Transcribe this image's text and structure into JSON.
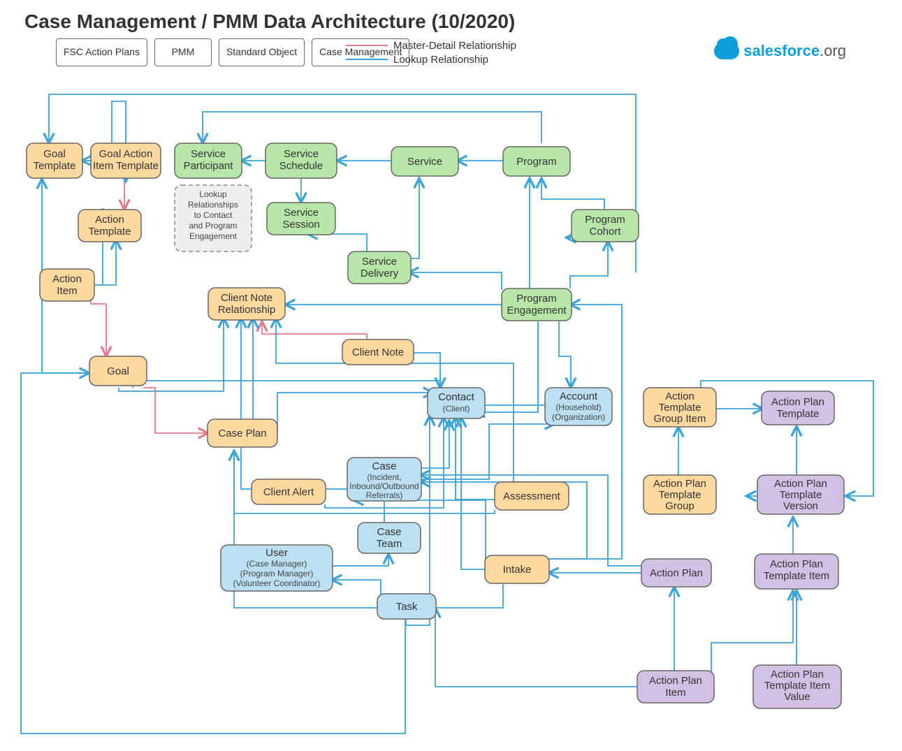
{
  "title": "Case Management / PMM Data Architecture  (10/2020)",
  "logo": {
    "brand": "salesforce",
    "suffix": ".org"
  },
  "colors": {
    "pmm": "#b7e6a8",
    "cm": "#fdd9a0",
    "fsc": "#d3c1e5",
    "std": "#bcdff1",
    "note": "#eeeeee",
    "lookup": "#3ba4d9",
    "master": "#e77a88"
  },
  "legend": {
    "fsc": "FSC Action Plans",
    "pmm": "PMM",
    "std": "Standard Object",
    "cm": "Case Management",
    "master": "Master-Detail Relationship",
    "lookup": "Lookup Relationship"
  },
  "nodes": {
    "goal_template": {
      "label": "Goal Template",
      "cat": "cm"
    },
    "goal_action_item_tmpl": {
      "label": "Goal Action Item Template",
      "cat": "cm"
    },
    "service_participant": {
      "label": "Service Participant",
      "cat": "pmm"
    },
    "service_schedule": {
      "label": "Service Schedule",
      "cat": "pmm"
    },
    "service": {
      "label": "Service",
      "cat": "pmm"
    },
    "program": {
      "label": "Program",
      "cat": "pmm"
    },
    "lookup_note": {
      "label": "Lookup Relationships to Contact and Program Engagement",
      "cat": "note"
    },
    "service_session": {
      "label": "Service Session",
      "cat": "pmm"
    },
    "program_cohort": {
      "label": "Program Cohort",
      "cat": "pmm"
    },
    "action_template": {
      "label": "Action Template",
      "cat": "cm"
    },
    "service_delivery": {
      "label": "Service Delivery",
      "cat": "pmm"
    },
    "action_item": {
      "label": "Action Item",
      "cat": "cm"
    },
    "client_note_rel": {
      "label": "Client Note Relationship",
      "cat": "cm"
    },
    "program_engagement": {
      "label": "Program Engagement",
      "cat": "pmm"
    },
    "client_note": {
      "label": "Client Note",
      "cat": "cm"
    },
    "goal": {
      "label": "Goal",
      "cat": "cm"
    },
    "case_plan": {
      "label": "Case Plan",
      "cat": "cm"
    },
    "contact": {
      "label": "Contact",
      "sub": "(Client)",
      "cat": "std"
    },
    "account": {
      "label": "Account",
      "sub": "(Household) (Organization)",
      "cat": "std"
    },
    "at_group_item": {
      "label": "Action Template Group Item",
      "cat": "cm"
    },
    "ap_template": {
      "label": "Action Plan Template",
      "cat": "fsc"
    },
    "case": {
      "label": "Case",
      "sub": "(Incident, Inbound/Outbound Referrals)",
      "cat": "std"
    },
    "client_alert": {
      "label": "Client Alert",
      "cat": "cm"
    },
    "assessment": {
      "label": "Assessment",
      "cat": "cm"
    },
    "ap_template_group": {
      "label": "Action Plan Template Group",
      "cat": "cm"
    },
    "ap_template_version": {
      "label": "Action Plan Template Version",
      "cat": "fsc"
    },
    "case_team": {
      "label": "Case Team",
      "cat": "std"
    },
    "user": {
      "label": "User",
      "sub": "(Case Manager) (Program Manager) (Volunteer Coordinator)",
      "cat": "std"
    },
    "intake": {
      "label": "Intake",
      "cat": "cm"
    },
    "action_plan": {
      "label": "Action Plan",
      "cat": "fsc"
    },
    "ap_template_item": {
      "label": "Action Plan Template Item",
      "cat": "fsc"
    },
    "task": {
      "label": "Task",
      "cat": "std"
    },
    "ap_item": {
      "label": "Action Plan Item",
      "cat": "fsc"
    },
    "ap_tmpl_item_value": {
      "label": "Action Plan Template Item Value",
      "cat": "fsc"
    }
  },
  "relationships": [
    {
      "from": "goal_action_item_tmpl",
      "to": "goal_template",
      "type": "lookup"
    },
    {
      "from": "goal_action_item_tmpl",
      "to": "action_template",
      "type": "master"
    },
    {
      "from": "action_item",
      "to": "action_template",
      "type": "lookup"
    },
    {
      "from": "action_item",
      "to": "goal_action_item_tmpl",
      "type": "lookup"
    },
    {
      "from": "action_item",
      "to": "goal",
      "type": "master"
    },
    {
      "from": "goal",
      "to": "goal_template",
      "type": "lookup"
    },
    {
      "from": "goal",
      "to": "case_plan",
      "type": "master"
    },
    {
      "from": "service_participant",
      "to": "service_schedule",
      "type": "lookup"
    },
    {
      "from": "service_schedule",
      "to": "service",
      "type": "lookup"
    },
    {
      "from": "service",
      "to": "program",
      "type": "lookup"
    },
    {
      "from": "service_session",
      "to": "service_schedule",
      "type": "lookup"
    },
    {
      "from": "service_delivery",
      "to": "service",
      "type": "lookup"
    },
    {
      "from": "service_delivery",
      "to": "service_session",
      "type": "lookup"
    },
    {
      "from": "service_delivery",
      "to": "program_engagement",
      "type": "lookup"
    },
    {
      "from": "program_cohort",
      "to": "program",
      "type": "lookup"
    },
    {
      "from": "program_engagement",
      "to": "program",
      "type": "lookup"
    },
    {
      "from": "program_engagement",
      "to": "program_cohort",
      "type": "lookup"
    },
    {
      "from": "program_engagement",
      "to": "contact",
      "type": "lookup"
    },
    {
      "from": "program_engagement",
      "to": "account",
      "type": "lookup"
    },
    {
      "from": "client_note_rel",
      "to": "client_note",
      "type": "master"
    },
    {
      "from": "client_note_rel",
      "to": "program_engagement",
      "type": "lookup"
    },
    {
      "from": "client_note_rel",
      "to": "goal",
      "type": "lookup"
    },
    {
      "from": "client_note_rel",
      "to": "case",
      "type": "lookup"
    },
    {
      "from": "client_note_rel",
      "to": "case_plan",
      "type": "lookup"
    },
    {
      "from": "client_note_rel",
      "to": "assessment",
      "type": "lookup"
    },
    {
      "from": "client_note",
      "to": "contact",
      "type": "lookup"
    },
    {
      "from": "goal",
      "to": "contact",
      "type": "lookup"
    },
    {
      "from": "case_plan",
      "to": "contact",
      "type": "lookup"
    },
    {
      "from": "contact",
      "to": "account",
      "type": "lookup"
    },
    {
      "from": "case",
      "to": "contact",
      "type": "lookup"
    },
    {
      "from": "case",
      "to": "account",
      "type": "lookup"
    },
    {
      "from": "client_alert",
      "to": "contact",
      "type": "lookup"
    },
    {
      "from": "assessment",
      "to": "contact",
      "type": "lookup"
    },
    {
      "from": "assessment",
      "to": "case_plan",
      "type": "lookup"
    },
    {
      "from": "case_team",
      "to": "case",
      "type": "lookup"
    },
    {
      "from": "intake",
      "to": "contact",
      "type": "lookup"
    },
    {
      "from": "intake",
      "to": "case",
      "type": "lookup"
    },
    {
      "from": "intake",
      "to": "case_plan",
      "type": "lookup"
    },
    {
      "from": "intake",
      "to": "program_engagement",
      "type": "lookup"
    },
    {
      "from": "task",
      "to": "user",
      "type": "lookup"
    },
    {
      "from": "task",
      "to": "contact",
      "type": "lookup"
    },
    {
      "from": "user",
      "to": "case_team",
      "type": "lookup"
    },
    {
      "from": "at_group_item",
      "to": "ap_template",
      "type": "lookup"
    },
    {
      "from": "at_group_item",
      "to": "ap_template_group",
      "type": "lookup"
    },
    {
      "from": "ap_template_version",
      "to": "ap_template",
      "type": "lookup"
    },
    {
      "from": "action_plan",
      "to": "ap_template_version",
      "type": "lookup"
    },
    {
      "from": "action_plan",
      "to": "intake",
      "type": "lookup"
    },
    {
      "from": "action_plan",
      "to": "case",
      "type": "lookup"
    },
    {
      "from": "ap_template_item",
      "to": "ap_template_version",
      "type": "lookup"
    },
    {
      "from": "ap_item",
      "to": "action_plan",
      "type": "lookup"
    },
    {
      "from": "ap_item",
      "to": "task",
      "type": "lookup"
    },
    {
      "from": "ap_item",
      "to": "ap_template_item",
      "type": "lookup"
    },
    {
      "from": "ap_tmpl_item_value",
      "to": "ap_template_item",
      "type": "lookup"
    }
  ]
}
